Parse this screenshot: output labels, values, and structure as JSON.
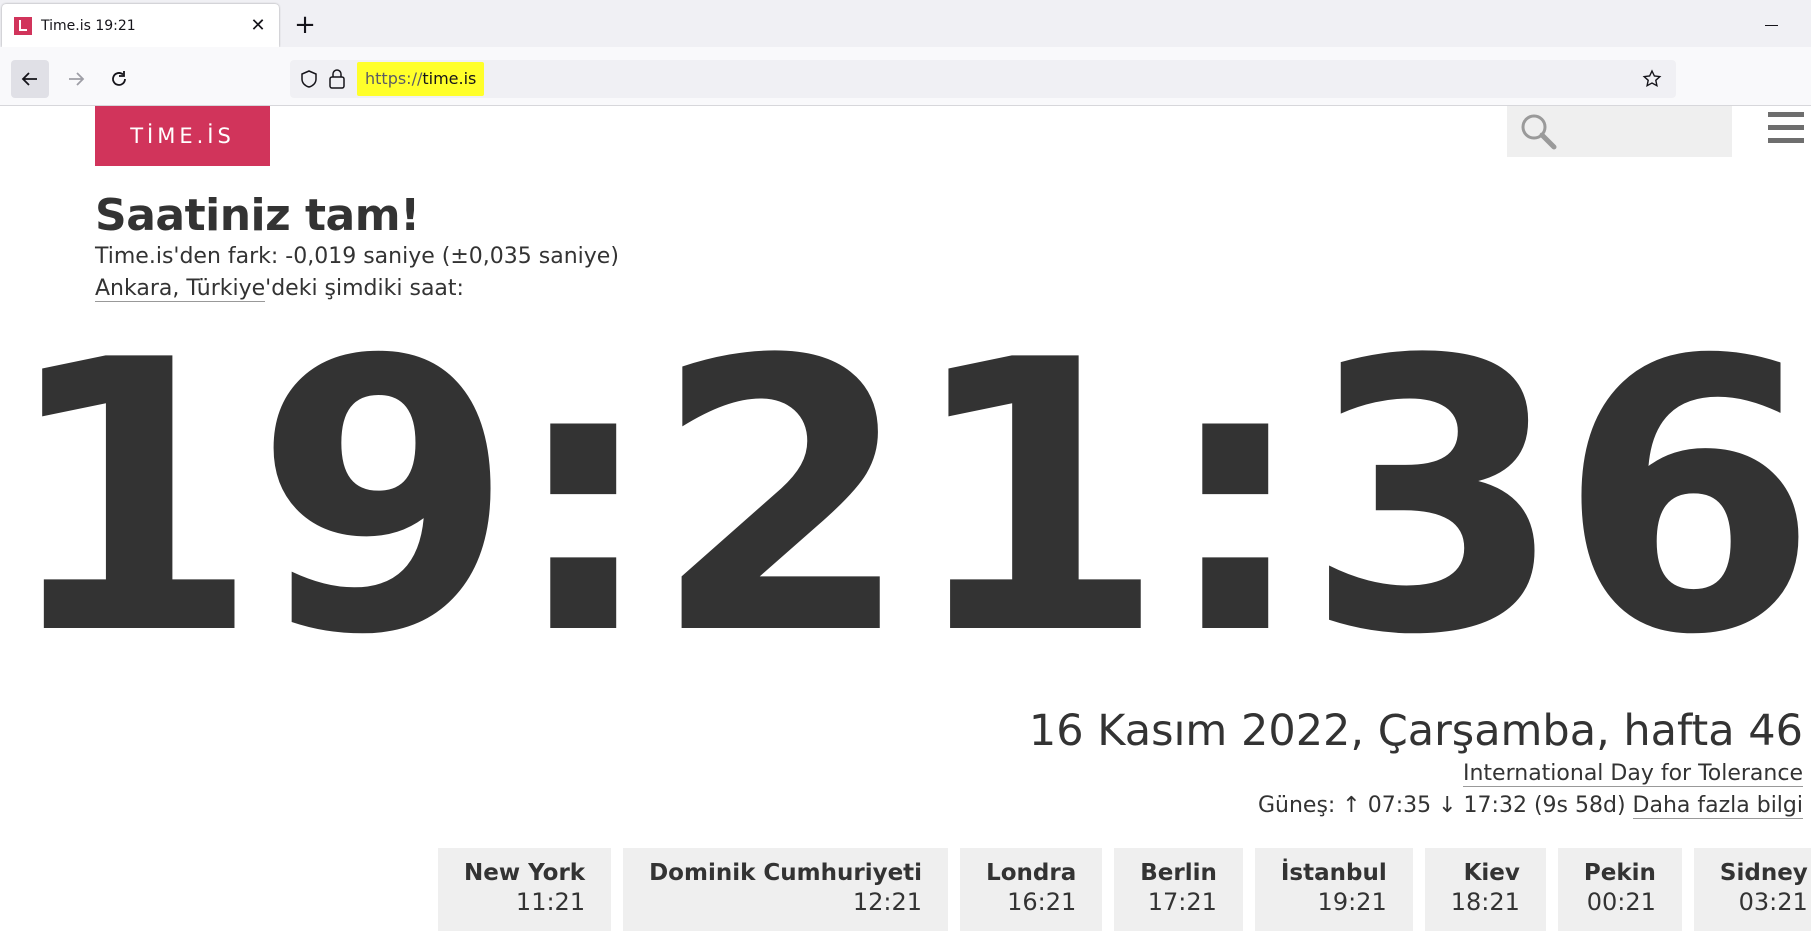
{
  "browser": {
    "tab_title": "Time.is 19:21",
    "close_glyph": "✕",
    "new_tab_glyph": "+",
    "url_scheme": "https://",
    "url_host": "time.is"
  },
  "site": {
    "logo_text": "TİME.İS",
    "brand_color": "#d1345b"
  },
  "page": {
    "heading": "Saatiniz tam!",
    "sync_text": "Time.is'den fark: -0,019 saniye (±0,035 saniye)",
    "location_link": "Ankara, Türkiye",
    "location_suffix": "'deki şimdiki saat:",
    "clock": "19:21:36",
    "date": "16 Kasım 2022, Çarşamba, hafta 46",
    "event_link": "International Day for Tolerance",
    "sun_prefix": "Güneş: ↑ 07:35 ↓ 17:32 (9s 58d) ",
    "sun_link": "Daha fazla bilgi"
  },
  "cities": [
    {
      "name": "New York",
      "time": "11:21"
    },
    {
      "name": "Dominik Cumhuriyeti",
      "time": "12:21"
    },
    {
      "name": "Londra",
      "time": "16:21"
    },
    {
      "name": "Berlin",
      "time": "17:21"
    },
    {
      "name": "İstanbul",
      "time": "19:21"
    },
    {
      "name": "Kiev",
      "time": "18:21"
    },
    {
      "name": "Pekin",
      "time": "00:21"
    },
    {
      "name": "Sidney",
      "time": "03:21"
    }
  ]
}
